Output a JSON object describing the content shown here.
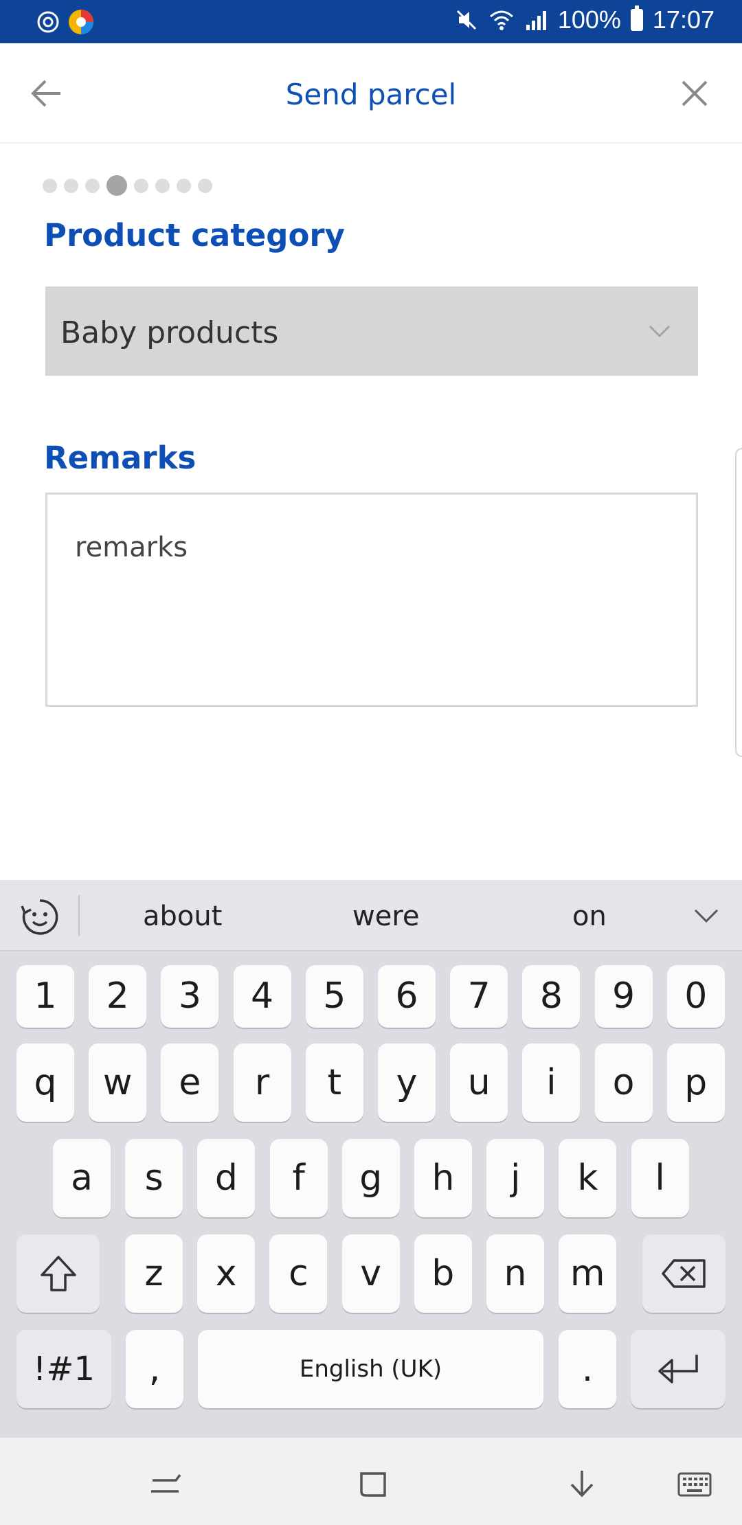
{
  "status_bar": {
    "battery": "100%",
    "time": "17:07",
    "icons": [
      "sync-icon",
      "browser-app-icon",
      "mute-icon",
      "wifi-icon",
      "signal-icon",
      "battery-icon"
    ]
  },
  "header": {
    "title": "Send parcel",
    "back_icon": "arrow-left-icon",
    "close_icon": "close-icon"
  },
  "progress": {
    "total_steps": 8,
    "current_step": 4
  },
  "form": {
    "category_label": "Product category",
    "category_value": "Baby products",
    "remarks_label": "Remarks",
    "remarks_placeholder": "remarks"
  },
  "keyboard": {
    "suggestions": [
      "about",
      "were",
      "on"
    ],
    "row_numbers": [
      "1",
      "2",
      "3",
      "4",
      "5",
      "6",
      "7",
      "8",
      "9",
      "0"
    ],
    "row_1": [
      "q",
      "w",
      "e",
      "r",
      "t",
      "y",
      "u",
      "i",
      "o",
      "p"
    ],
    "row_2": [
      "a",
      "s",
      "d",
      "f",
      "g",
      "h",
      "j",
      "k",
      "l"
    ],
    "row_3": [
      "z",
      "x",
      "c",
      "v",
      "b",
      "n",
      "m"
    ],
    "symbols_key": "!#1",
    "comma_key": ",",
    "space_key": "English (UK)",
    "period_key": "."
  },
  "colors": {
    "brand_blue": "#0d4fb5",
    "status_bar": "#0d4497",
    "select_bg": "#d6d6d6"
  }
}
